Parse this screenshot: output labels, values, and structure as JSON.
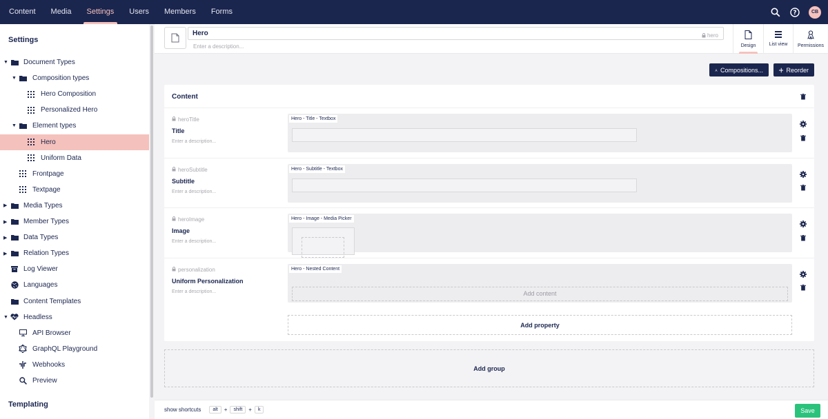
{
  "topnav": {
    "items": [
      {
        "label": "Content",
        "active": false
      },
      {
        "label": "Media",
        "active": false
      },
      {
        "label": "Settings",
        "active": true
      },
      {
        "label": "Users",
        "active": false
      },
      {
        "label": "Members",
        "active": false
      },
      {
        "label": "Forms",
        "active": false
      }
    ],
    "avatar_initials": "CB"
  },
  "sidebar": {
    "heading": "Settings",
    "footer_heading": "Templating",
    "tree": [
      {
        "label": "Document Types",
        "icon": "folder-icon",
        "level": 0,
        "caret": "down"
      },
      {
        "label": "Composition types",
        "icon": "folder-icon",
        "level": 1,
        "caret": "down"
      },
      {
        "label": "Hero Composition",
        "icon": "grid-icon",
        "level": 2,
        "caret": "none"
      },
      {
        "label": "Personalized Hero",
        "icon": "grid-icon",
        "level": 2,
        "caret": "none"
      },
      {
        "label": "Element types",
        "icon": "folder-icon",
        "level": 1,
        "caret": "down"
      },
      {
        "label": "Hero",
        "icon": "grid-icon",
        "level": 2,
        "caret": "none",
        "active": true
      },
      {
        "label": "Uniform Data",
        "icon": "grid-icon",
        "level": 2,
        "caret": "none"
      },
      {
        "label": "Frontpage",
        "icon": "grid-icon",
        "level": 1,
        "caret": "none"
      },
      {
        "label": "Textpage",
        "icon": "grid-icon",
        "level": 1,
        "caret": "none"
      },
      {
        "label": "Media Types",
        "icon": "folder-icon",
        "level": 0,
        "caret": "right"
      },
      {
        "label": "Member Types",
        "icon": "folder-icon",
        "level": 0,
        "caret": "right"
      },
      {
        "label": "Data Types",
        "icon": "folder-icon",
        "level": 0,
        "caret": "right"
      },
      {
        "label": "Relation Types",
        "icon": "folder-icon",
        "level": 0,
        "caret": "right"
      },
      {
        "label": "Log Viewer",
        "icon": "box-icon",
        "level": 0,
        "caret": "none"
      },
      {
        "label": "Languages",
        "icon": "globe-icon",
        "level": 0,
        "caret": "none"
      },
      {
        "label": "Content Templates",
        "icon": "folder-icon",
        "level": 0,
        "caret": "none"
      },
      {
        "label": "Headless",
        "icon": "heart-icon",
        "level": 0,
        "caret": "down"
      },
      {
        "label": "API Browser",
        "icon": "monitor-icon",
        "level": 1,
        "caret": "none"
      },
      {
        "label": "GraphQL Playground",
        "icon": "graphql-icon",
        "level": 1,
        "caret": "none"
      },
      {
        "label": "Webhooks",
        "icon": "webhook-icon",
        "level": 1,
        "caret": "none"
      },
      {
        "label": "Preview",
        "icon": "search-icon",
        "level": 1,
        "caret": "none"
      }
    ]
  },
  "editor": {
    "name": "Hero",
    "alias": "hero",
    "description_placeholder": "Enter a description...",
    "apps": [
      {
        "label": "Design",
        "icon": "document-icon",
        "active": true
      },
      {
        "label": "List view",
        "icon": "list-icon",
        "active": false
      },
      {
        "label": "Permissions",
        "icon": "permissions-icon",
        "active": false
      }
    ],
    "compositions_label": "Compositions...",
    "reorder_label": "Reorder",
    "group": {
      "title": "Content",
      "properties": [
        {
          "alias": "heroTitle",
          "label": "Title",
          "description": "Enter a description...",
          "editor": "Hero - Title - Textbox",
          "kind": "textbox"
        },
        {
          "alias": "heroSubtitle",
          "label": "Subtitle",
          "description": "Enter a description...",
          "editor": "Hero - Subtitle - Textbox",
          "kind": "textbox"
        },
        {
          "alias": "heroImage",
          "label": "Image",
          "description": "Enter a description...",
          "editor": "Hero - Image - Media Picker",
          "kind": "media"
        },
        {
          "alias": "personalization",
          "label": "Uniform Personalization",
          "description": "Enter a description...",
          "editor": "Hero - Nested Content",
          "kind": "nested",
          "add_content_label": "Add content"
        }
      ],
      "add_property_label": "Add property"
    },
    "add_group_label": "Add group"
  },
  "footer": {
    "shortcuts_label": "show shortcuts",
    "keys": [
      "alt",
      "shift",
      "k"
    ],
    "save_label": "Save"
  },
  "colors": {
    "navy": "#1b264f",
    "pink": "#f5c1bc",
    "green": "#2bc37c"
  }
}
